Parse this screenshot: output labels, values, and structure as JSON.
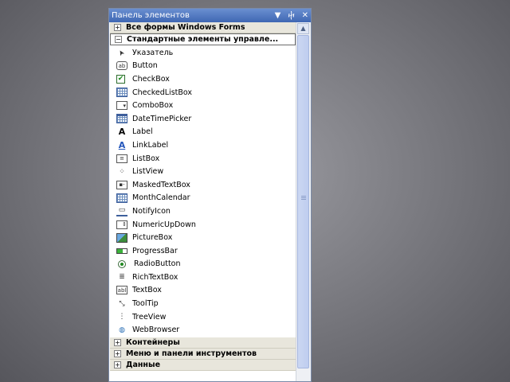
{
  "window": {
    "title": "Панель элементов",
    "buttons": {
      "dropdown": "▼",
      "pin": "ⴕ",
      "close": "✕"
    }
  },
  "sections": {
    "all_forms": {
      "toggle": "+",
      "label": "Все формы Windows Forms"
    },
    "standard": {
      "toggle": "−",
      "label": "Стандартные элементы управле..."
    },
    "containers": {
      "toggle": "+",
      "label": "Контейнеры"
    },
    "menus": {
      "toggle": "+",
      "label": "Меню и панели инструментов"
    },
    "data": {
      "toggle": "+",
      "label": "Данные"
    }
  },
  "items": [
    {
      "label": "Указатель",
      "icon": "pointer-icon"
    },
    {
      "label": "Button",
      "icon": "button-icon"
    },
    {
      "label": "CheckBox",
      "icon": "checkbox-icon"
    },
    {
      "label": "CheckedListBox",
      "icon": "checkedlistbox-icon"
    },
    {
      "label": "ComboBox",
      "icon": "combobox-icon"
    },
    {
      "label": "DateTimePicker",
      "icon": "datetimepicker-icon"
    },
    {
      "label": "Label",
      "icon": "label-icon"
    },
    {
      "label": "LinkLabel",
      "icon": "linklabel-icon"
    },
    {
      "label": "ListBox",
      "icon": "listbox-icon"
    },
    {
      "label": "ListView",
      "icon": "listview-icon"
    },
    {
      "label": "MaskedTextBox",
      "icon": "maskedtextbox-icon"
    },
    {
      "label": "MonthCalendar",
      "icon": "monthcalendar-icon"
    },
    {
      "label": "NotifyIcon",
      "icon": "notifyicon-icon"
    },
    {
      "label": "NumericUpDown",
      "icon": "numericupdown-icon"
    },
    {
      "label": "PictureBox",
      "icon": "picturebox-icon"
    },
    {
      "label": "ProgressBar",
      "icon": "progressbar-icon"
    },
    {
      "label": "RadioButton",
      "icon": "radiobutton-icon"
    },
    {
      "label": "RichTextBox",
      "icon": "richtextbox-icon"
    },
    {
      "label": "TextBox",
      "icon": "textbox-icon"
    },
    {
      "label": "ToolTip",
      "icon": "tooltip-icon"
    },
    {
      "label": "TreeView",
      "icon": "treeview-icon"
    },
    {
      "label": "WebBrowser",
      "icon": "webbrowser-icon"
    }
  ],
  "icon_glyphs": {
    "pointer": "➤",
    "button": "ab",
    "checkbox": "✔",
    "combobox": "▾",
    "label": "A",
    "linklabel": "A",
    "listbox": "≡",
    "listview": "⁘",
    "maskedtextbox": "▪-",
    "notifyicon": "▭",
    "numericupdown": "⇕",
    "richtextbox": "≣",
    "textbox": "abl",
    "tooltip": "⤡",
    "treeview": "⋮",
    "webbrowser": "◍",
    "scroll_up": "▲"
  }
}
